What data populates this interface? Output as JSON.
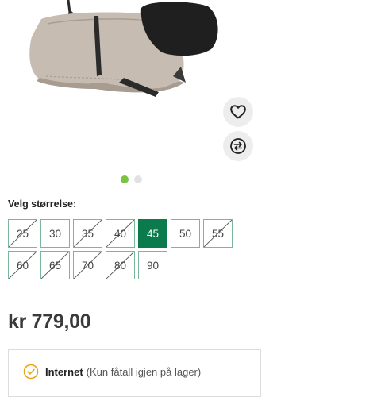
{
  "product": {
    "image_alt": "Dog coat product photo"
  },
  "actions": {
    "favorite_icon": "heart-icon",
    "compare_icon": "compare-arrows-icon"
  },
  "carousel": {
    "count": 2,
    "active_index": 0,
    "active_color": "#7cc243"
  },
  "sizes": {
    "label": "Velg størrelse:",
    "rows": [
      [
        {
          "value": "25",
          "available": false
        },
        {
          "value": "30",
          "available": true
        },
        {
          "value": "35",
          "available": false
        },
        {
          "value": "40",
          "available": false
        },
        {
          "value": "45",
          "available": true,
          "selected": true
        },
        {
          "value": "50",
          "available": true
        },
        {
          "value": "55",
          "available": false
        }
      ],
      [
        {
          "value": "60",
          "available": false
        },
        {
          "value": "65",
          "available": false
        },
        {
          "value": "70",
          "available": false
        },
        {
          "value": "80",
          "available": false
        },
        {
          "value": "90",
          "available": true
        }
      ]
    ],
    "selected_color": "#0b7a4c"
  },
  "price": {
    "text": "kr 779,00"
  },
  "stock": {
    "channel": "Internet",
    "note": "(Kun fåtall igjen på lager)",
    "status_color": "#e8a317"
  }
}
